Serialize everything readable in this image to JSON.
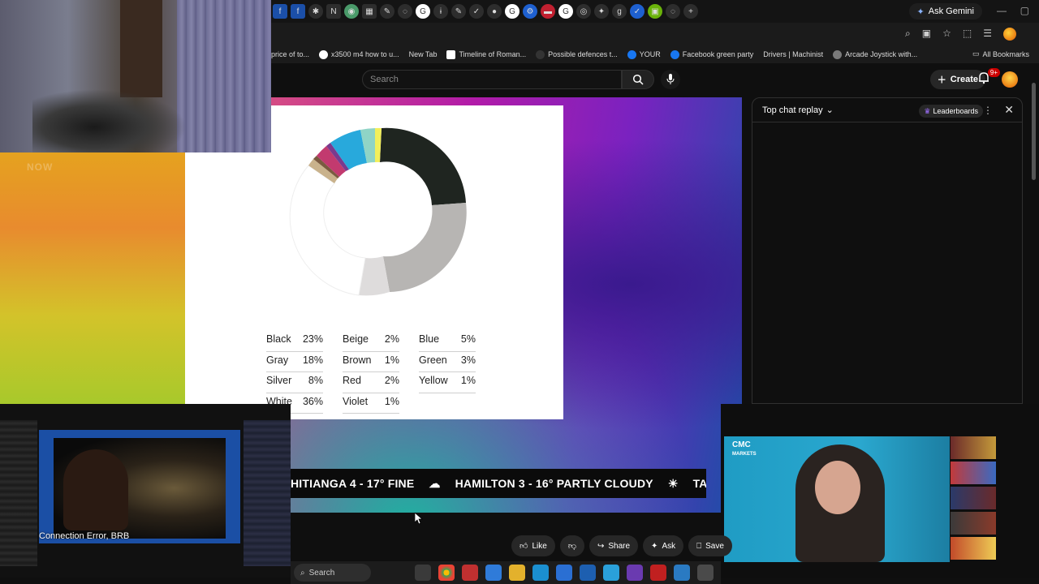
{
  "browser": {
    "ask_gemini": "Ask Gemini",
    "bookmarks": [
      "price of to...",
      "x3500 m4 how to u...",
      "New Tab",
      "Timeline of Roman...",
      "Possible defences t...",
      "YOUR",
      "Facebook green party",
      "Drivers | Machinist",
      "Arcade Joystick with..."
    ],
    "all_bookmarks": "All Bookmarks"
  },
  "youtube": {
    "search_placeholder": "Search",
    "create_label": "Create",
    "notification_count": "9+"
  },
  "slide": {
    "legend": [
      {
        "name": "Black",
        "pct": "23%"
      },
      {
        "name": "Beige",
        "pct": "2%"
      },
      {
        "name": "Blue",
        "pct": "5%"
      },
      {
        "name": "Gray",
        "pct": "18%"
      },
      {
        "name": "Brown",
        "pct": "1%"
      },
      {
        "name": "Green",
        "pct": "3%"
      },
      {
        "name": "Silver",
        "pct": "8%"
      },
      {
        "name": "Red",
        "pct": "2%"
      },
      {
        "name": "Yellow",
        "pct": "1%"
      },
      {
        "name": "White",
        "pct": "36%"
      },
      {
        "name": "Violet",
        "pct": "1%"
      }
    ]
  },
  "ticker": {
    "items": [
      "HITIANGA 4 - 17° FINE",
      "HAMILTON 3 - 16° PARTLY CLOUDY",
      "TAUF"
    ]
  },
  "overlay": {
    "now_text": "NOW",
    "connection_error": "Connection Error, BRB"
  },
  "chat": {
    "title": "Top chat replay",
    "leaderboards": "Leaderboards"
  },
  "actions": {
    "like": "Like",
    "share": "Share",
    "ask": "Ask",
    "save": "Save"
  },
  "taskbar": {
    "search": "Search"
  },
  "colors": {
    "youtube_red": "#ff0000",
    "notification_red": "#cc0000"
  }
}
